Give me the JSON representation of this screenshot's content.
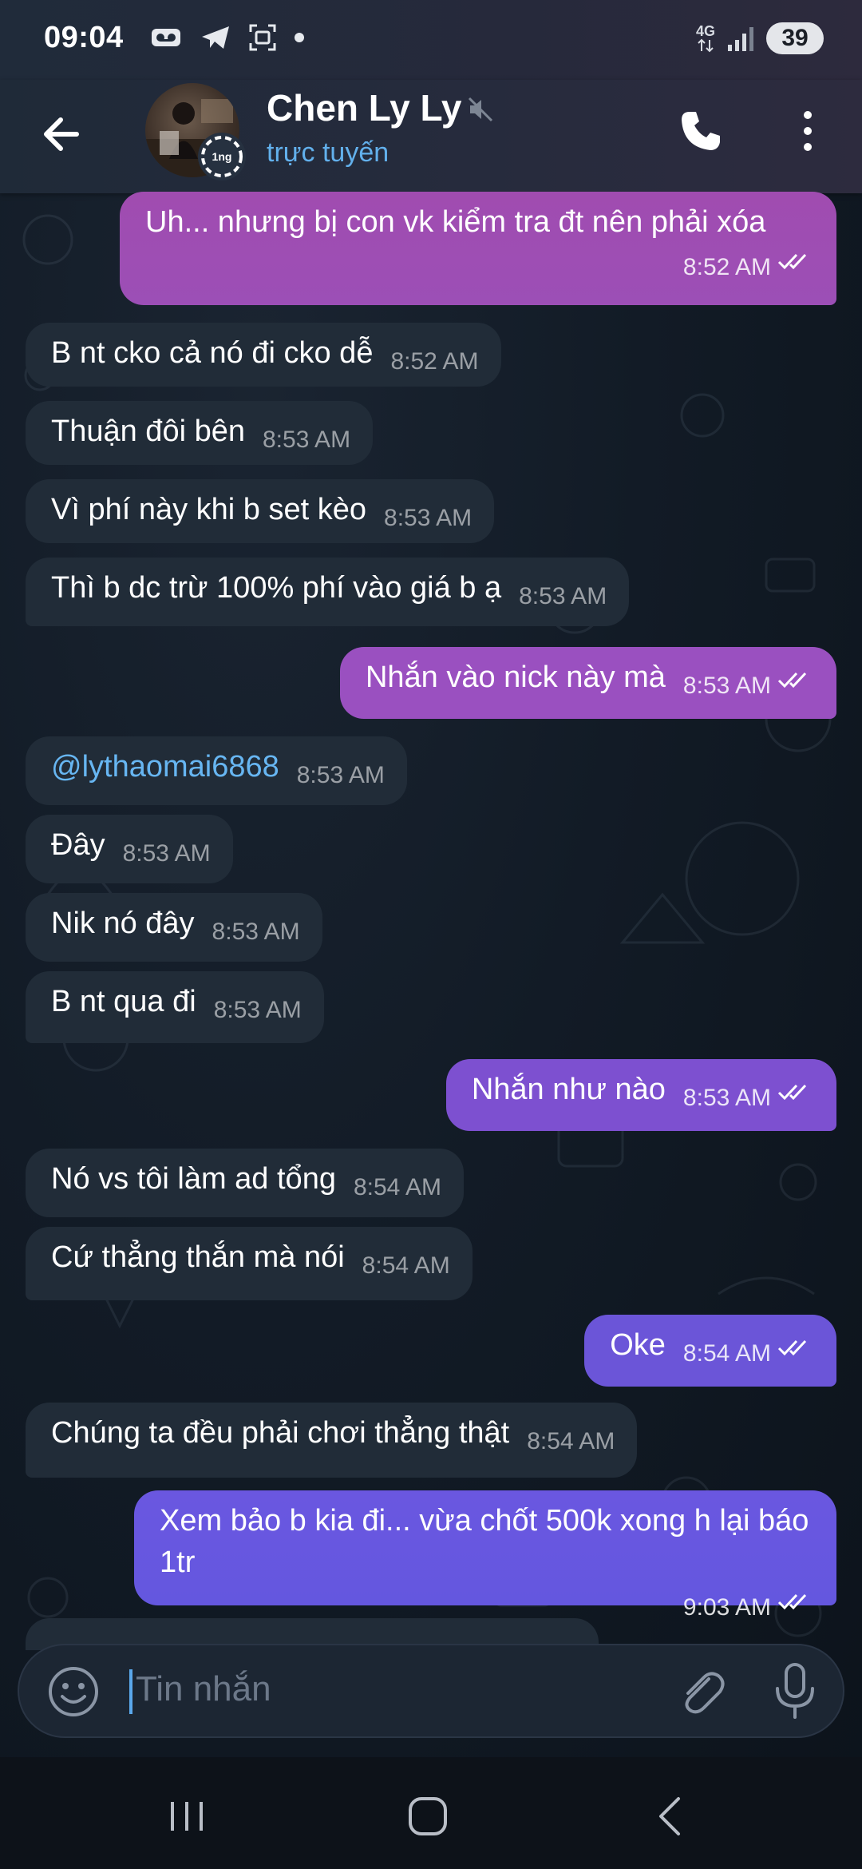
{
  "status_bar": {
    "time": "09:04",
    "network": "4G",
    "battery": "39"
  },
  "header": {
    "contact_name": "Chen Ly Ly",
    "status": "trực tuyến",
    "avatar_badge": "1ng"
  },
  "messages": [
    {
      "dir": "out",
      "text": "Uh... nhưng bị con vk kiểm tra đt nên phải xóa",
      "time": "8:52 AM",
      "read": true
    },
    {
      "dir": "in",
      "text": "B nt cko cả nó đi cko dễ",
      "time": "8:52 AM"
    },
    {
      "dir": "in",
      "text": "Thuận đôi bên",
      "time": "8:53 AM"
    },
    {
      "dir": "in",
      "text": "Vì phí này khi b set kèo",
      "time": "8:53 AM"
    },
    {
      "dir": "in",
      "text": "Thì b dc trừ 100% phí vào giá b ạ",
      "time": "8:53 AM"
    },
    {
      "dir": "out",
      "text": "Nhắn vào nick này mà",
      "time": "8:53 AM",
      "read": true
    },
    {
      "dir": "in",
      "text": "@lythaomai6868",
      "time": "8:53 AM"
    },
    {
      "dir": "in",
      "text": "Đây",
      "time": "8:53 AM"
    },
    {
      "dir": "in",
      "text": "Nik nó đây",
      "time": "8:53 AM"
    },
    {
      "dir": "in",
      "text": "B nt qua đi",
      "time": "8:53 AM"
    },
    {
      "dir": "out",
      "text": "Nhắn như nào",
      "time": "8:53 AM",
      "read": true
    },
    {
      "dir": "in",
      "text": "Nó vs tôi làm ad tổng",
      "time": "8:54 AM"
    },
    {
      "dir": "in",
      "text": "Cứ thẳng thắn mà nói",
      "time": "8:54 AM"
    },
    {
      "dir": "out",
      "text": "Oke",
      "time": "8:54 AM",
      "read": true
    },
    {
      "dir": "in",
      "text": "Chúng ta đều phải chơi thẳng thật",
      "time": "8:54 AM"
    },
    {
      "dir": "out",
      "text": "Xem bảo b kia đi... vừa chốt 500k xong h lại báo 1tr",
      "time": "9:03 AM",
      "read": true
    }
  ],
  "input": {
    "placeholder": "Tin nhắn"
  },
  "colors": {
    "incoming_bubble": "#212c38",
    "outgoing_gradient_top": "#a34fb0",
    "outgoing_gradient_bottom": "#6a57e0",
    "status_online": "#62b0ec",
    "mention": "#67b6f2"
  },
  "icons": {
    "back": "arrow-left-icon",
    "mute": "muted-speaker-icon",
    "call": "phone-icon",
    "menu": "more-vertical-icon",
    "emoji": "smiley-icon",
    "attach": "paperclip-icon",
    "mic": "microphone-icon",
    "read": "double-check-icon"
  }
}
